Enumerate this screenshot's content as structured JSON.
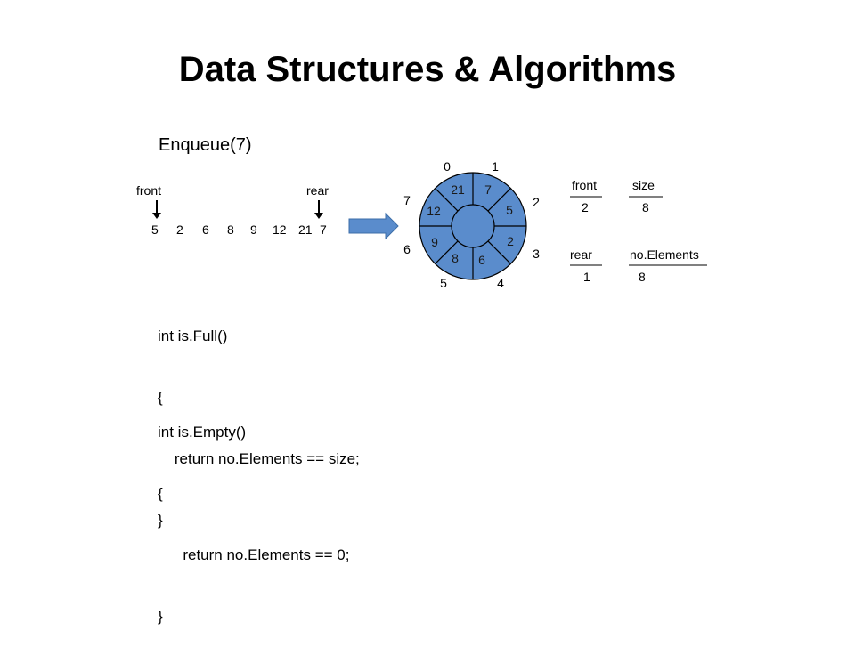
{
  "title": "Data Structures & Algorithms",
  "operation": "Enqueue(7)",
  "linear": {
    "front_label": "front",
    "rear_label": "rear",
    "values": [
      "5",
      "2",
      "6",
      "8",
      "9",
      "12",
      "21",
      "7"
    ]
  },
  "circular": {
    "indices": [
      "0",
      "1",
      "2",
      "3",
      "4",
      "5",
      "6",
      "7"
    ],
    "values": [
      "21",
      "7",
      "5",
      "2",
      "6",
      "8",
      "9",
      "12"
    ],
    "fill": "#5a8ccc"
  },
  "vars": {
    "front_label": "front",
    "front_value": "2",
    "size_label": "size",
    "size_value": "8",
    "rear_label": "rear",
    "rear_value": "1",
    "noelements_label": "no.Elements",
    "noelements_value": "8"
  },
  "code": {
    "isfull": [
      "int is.Full()",
      "{",
      "    return no.Elements == size;",
      "}"
    ],
    "isempty": [
      "int is.Empty()",
      "{",
      "      return no.Elements == 0;",
      "}"
    ]
  }
}
